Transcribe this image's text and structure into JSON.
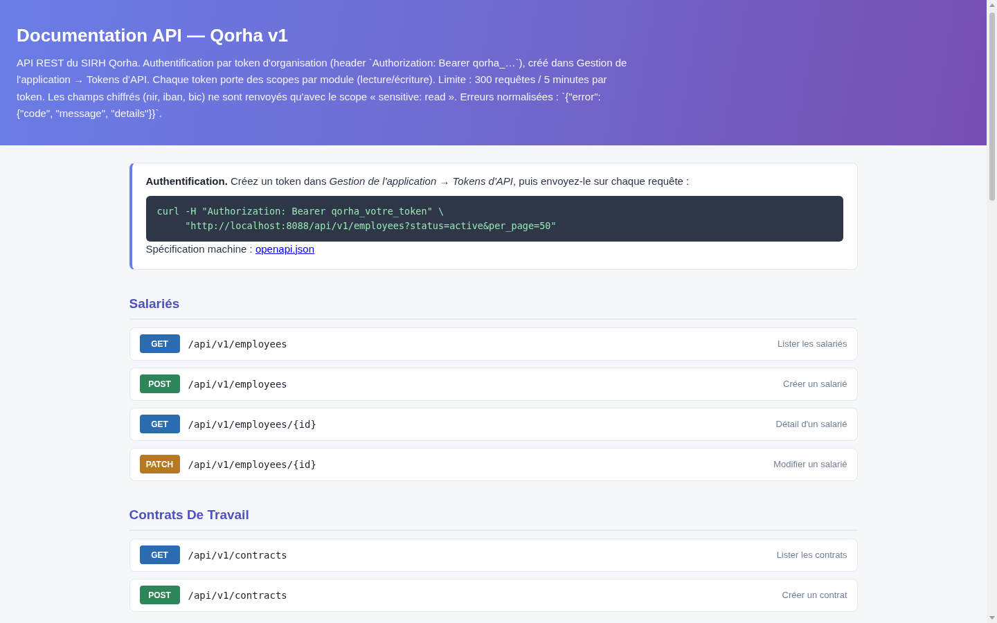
{
  "header": {
    "title": "Documentation API — Qorha v1",
    "description": "API REST du SIRH Qorha. Authentification par token d'organisation (header `Authorization: Bearer qorha_…`), créé dans Gestion de l'application → Tokens d'API. Chaque token porte des scopes par module (lecture/écriture). Limite : 300 requêtes / 5 minutes par token. Les champs chiffrés (nir, iban, bic) ne sont renvoyés qu'avec le scope « sensitive: read ». Erreurs normalisées : `{\"error\": {\"code\", \"message\", \"details\"}}`."
  },
  "auth": {
    "note": "**Authentification.** Créez un token dans *Gestion de l'application* → *Tokens d'API*, puis envoyez-le sur chaque requête :",
    "code_lines": [
      "curl -H \"Authorization: Bearer qorha_votre_token\" \\",
      "     \"http://localhost:8088/api/v1/employees?status=active&per_page=50\""
    ],
    "spec_label": "Spécification machine :",
    "spec_link": "openapi.json"
  },
  "sections": [
    {
      "title": "Salariés",
      "endpoints": [
        {
          "method": "GET",
          "color": "#2b6cb0",
          "path": "/api/v1/employees",
          "summary": "Lister les salariés"
        },
        {
          "method": "POST",
          "color": "#2f855a",
          "path": "/api/v1/employees",
          "summary": "Créer un salarié"
        },
        {
          "method": "GET",
          "color": "#2b6cb0",
          "path": "/api/v1/employees/{id}",
          "summary": "Détail d'un salarié"
        },
        {
          "method": "PATCH",
          "color": "#b7791f",
          "path": "/api/v1/employees/{id}",
          "summary": "Modifier un salarié"
        }
      ]
    },
    {
      "title": "Contrats De Travail",
      "endpoints": [
        {
          "method": "GET",
          "color": "#2b6cb0",
          "path": "/api/v1/contracts",
          "summary": "Lister les contrats"
        },
        {
          "method": "POST",
          "color": "#2f855a",
          "path": "/api/v1/contracts",
          "summary": "Créer un contrat"
        }
      ]
    }
  ]
}
